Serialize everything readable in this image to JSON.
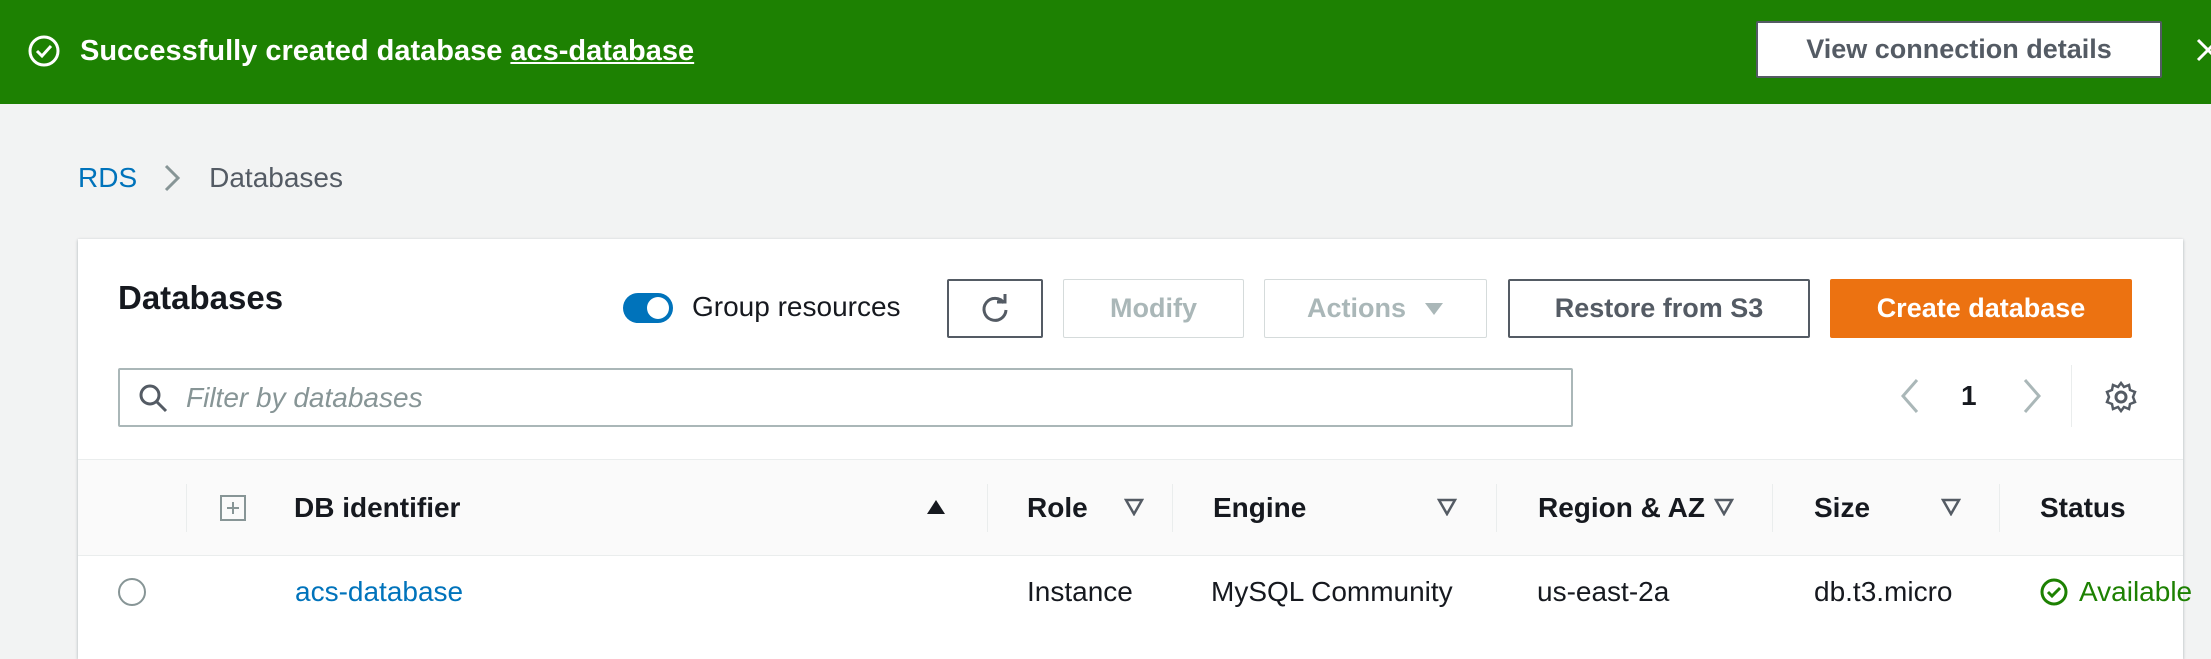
{
  "flash": {
    "message": "Successfully created database ",
    "database_link": "acs-database",
    "view_button": "View connection details"
  },
  "breadcrumb": {
    "root": "RDS",
    "current": "Databases"
  },
  "panel": {
    "title": "Databases",
    "group_toggle_label": "Group resources",
    "group_toggle_on": true,
    "modify_label": "Modify",
    "actions_label": "Actions",
    "restore_label": "Restore from S3",
    "create_label": "Create database",
    "search_placeholder": "Filter by databases",
    "page_number": "1"
  },
  "table": {
    "columns": [
      "DB identifier",
      "Role",
      "Engine",
      "Region & AZ",
      "Size",
      "Status"
    ],
    "rows": [
      {
        "identifier": "acs-database",
        "role": "Instance",
        "engine": "MySQL Community",
        "region": "us-east-2a",
        "size": "db.t3.micro",
        "status": "Available"
      }
    ]
  },
  "colors": {
    "success": "#1d8102",
    "link": "#0073bb",
    "primary": "#ec7211"
  }
}
